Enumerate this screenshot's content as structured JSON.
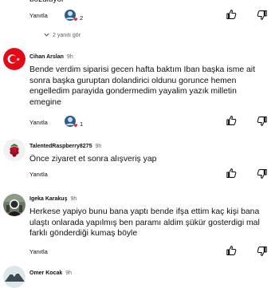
{
  "top": {
    "cut_text": "bozuluyor",
    "reply_label": "Yanıtla",
    "heart_count": "2",
    "replies_label": "2 yanıtı gör"
  },
  "comments": [
    {
      "author": "Cihan Arslan",
      "time": "9h",
      "text": "Bende verdim siparisi gecen hafta baktım Iban başka isme ait sonra başka guruptan dolandirici oldunu gorunce hemen engelledim parayida gondermedim yayalim yazık milletin emegine",
      "reply_label": "Yanıtla",
      "heart_count": "1",
      "avatar": "turkish-flag-avatar"
    },
    {
      "author": "TalentedRaspberry8275",
      "time": "9h",
      "text": "Önce ziyaret et sonra alışveriş yap",
      "reply_label": "Yanıtla",
      "avatar": "raspberry-avatar"
    },
    {
      "author": "Igeka Karakuş",
      "time": "9h",
      "text": "Herkese yapiyo bunu bana yaptı bende ifşa ettim kaç kişi bana ulaştı onlarada yapılmış ben paramı aldim şükür gosterdigi mal farklı gönderdiği kumaş böyle",
      "reply_label": "Yanıtla",
      "avatar": "photo-avatar"
    },
    {
      "author": "Omer Kocak",
      "time": "9h",
      "avatar": "mountain-avatar"
    }
  ],
  "colors": {
    "flag_red": "#e30a17",
    "heart_red": "#e52d27",
    "text": "#0f0f0f",
    "muted": "#606060",
    "link_blue": "#065fd4"
  }
}
